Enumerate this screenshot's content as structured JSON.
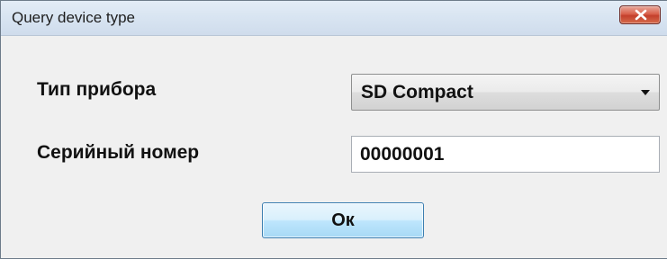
{
  "window": {
    "title": "Query device type",
    "close_icon": "close-icon",
    "accent_close": "#c3402c"
  },
  "form": {
    "device_type_label": "Тип прибора",
    "device_type_value": "SD Compact",
    "serial_label": "Серийный номер",
    "serial_value": "00000001"
  },
  "actions": {
    "ok_label": "Ок"
  }
}
